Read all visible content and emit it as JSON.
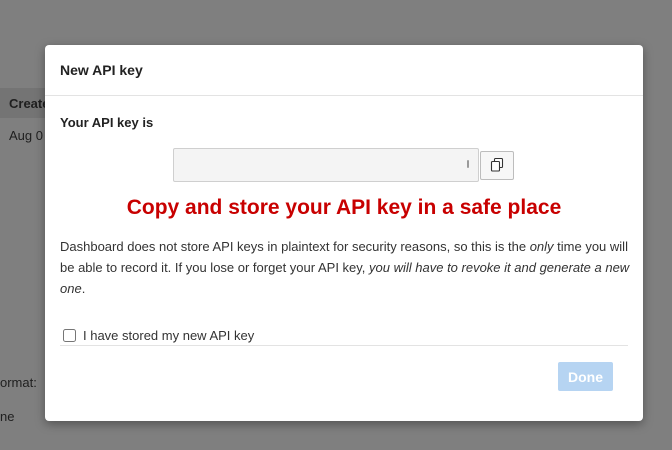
{
  "background": {
    "column_header": "Create",
    "date_cell": "Aug 0",
    "format_label": "ormat:",
    "ne_label": "ne"
  },
  "modal": {
    "title": "New API key",
    "key_label": "Your API key is",
    "key_value": "",
    "copy_icon": "copy-icon",
    "warning": "Copy and store your API key in a safe place",
    "description": {
      "part1": "Dashboard does not store API keys in plaintext for security reasons, so this is the ",
      "only": "only",
      "part2": " time you will be able to record it. If you lose or forget your API key, ",
      "revoke": "you will have to revoke it and generate a new one",
      "part3": "."
    },
    "checkbox_label": "I have stored my new API key",
    "checkbox_checked": false,
    "done_label": "Done",
    "colors": {
      "warning": "#c80000",
      "done_disabled": "#b6d4f2",
      "overlay": "#808080"
    }
  }
}
